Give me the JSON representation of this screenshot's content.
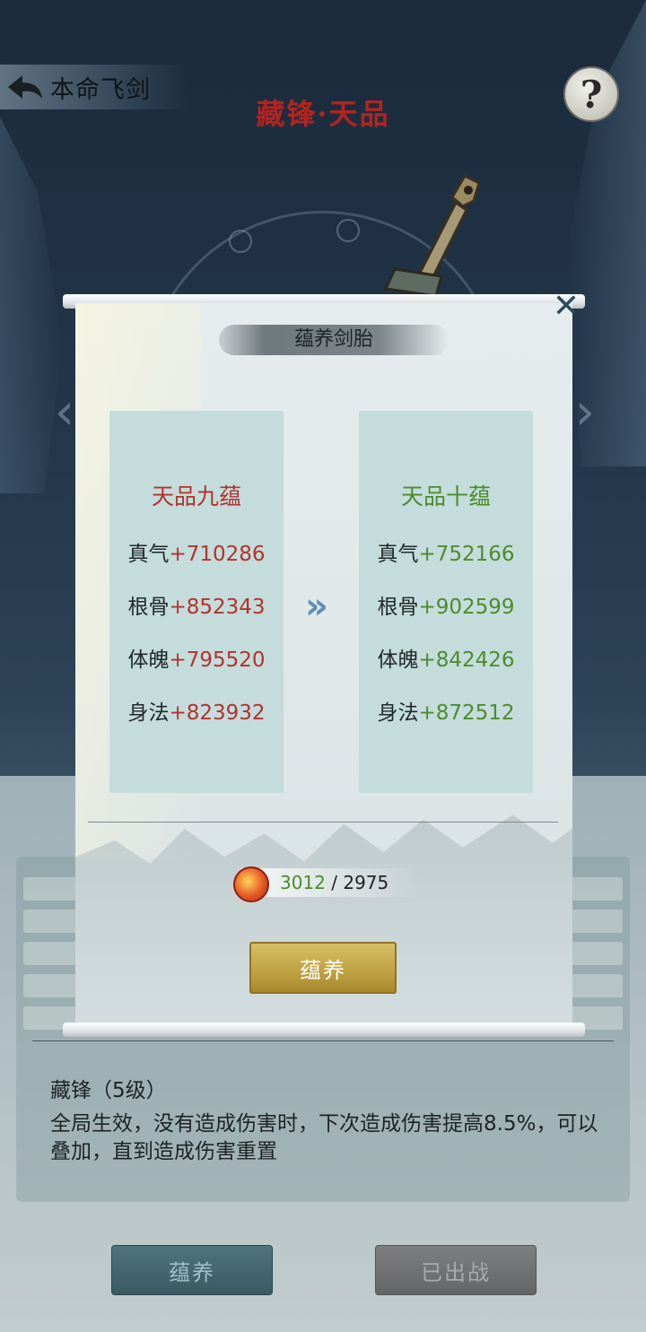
{
  "header": {
    "back_label": "本命飞剑",
    "help_label": "?",
    "sword_title": "藏锋·天品"
  },
  "modal": {
    "title": "蕴养剑胎",
    "close_label": "✕",
    "current": {
      "rank": "天品九蕴",
      "stats": [
        {
          "name": "真气",
          "value": "+710286"
        },
        {
          "name": "根骨",
          "value": "+852343"
        },
        {
          "name": "体魄",
          "value": "+795520"
        },
        {
          "name": "身法",
          "value": "+823932"
        }
      ]
    },
    "next": {
      "rank": "天品十蕴",
      "stats": [
        {
          "name": "真气",
          "value": "+752166"
        },
        {
          "name": "根骨",
          "value": "+902599"
        },
        {
          "name": "体魄",
          "value": "+842426"
        },
        {
          "name": "身法",
          "value": "+872512"
        }
      ]
    },
    "arrow": "»",
    "cost": {
      "have": "3012",
      "separator": " / ",
      "need": "2975"
    },
    "button_label": "蕴养"
  },
  "skill": {
    "name": "藏锋（5级）",
    "description": "全局生效，没有造成伤害时，下次造成伤害提高8.5%，可以叠加，直到造成伤害重置"
  },
  "bottom_buttons": {
    "cultivate": "蕴养",
    "deployed": "已出战"
  },
  "colors": {
    "current_rank": "#b2332d",
    "next_rank": "#4d8b2c",
    "modal_button": "#bfa142"
  }
}
